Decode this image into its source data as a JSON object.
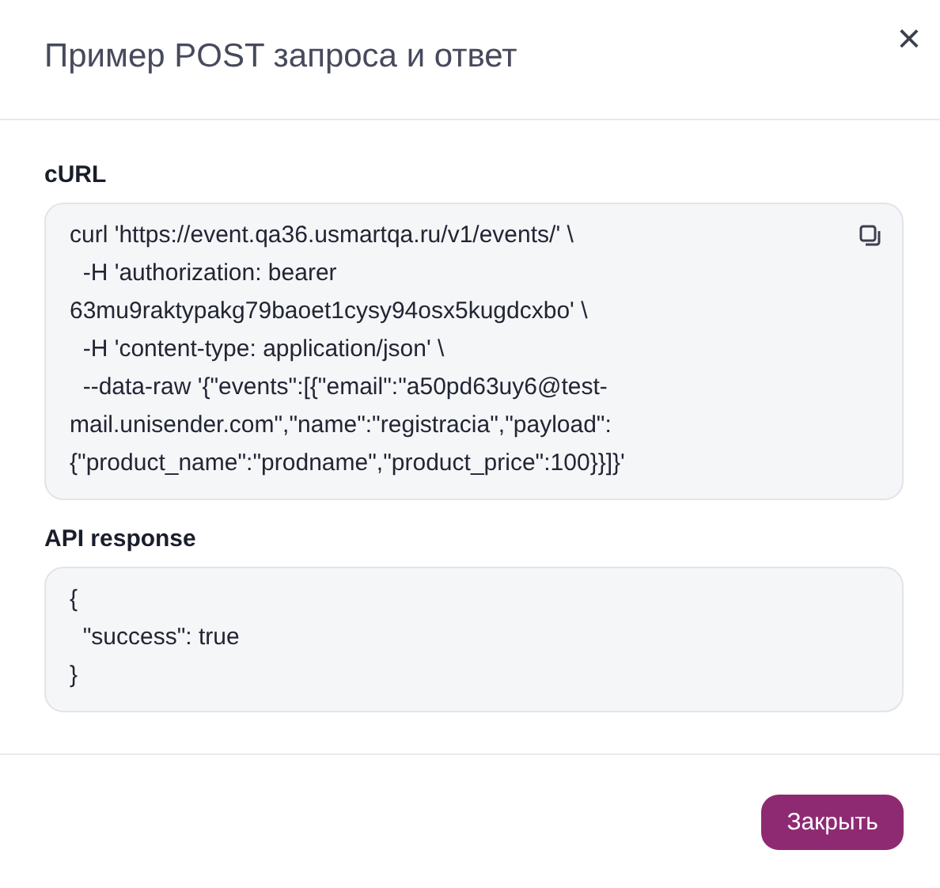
{
  "dialog": {
    "title": "Пример POST запроса и ответ",
    "close": "×"
  },
  "sections": [
    {
      "label": "cURL",
      "copyable": true,
      "lines": [
        "curl 'https://event.qa36.usmartqa.ru/v1/events/' \\",
        "  -H 'authorization: bearer",
        "63mu9raktypakg79baoet1cysy94osx5kugdcxbo' \\",
        "  -H 'content-type: application/json' \\",
        "  --data-raw '{\"events\":[{\"email\":\"a50pd63uy6@test-",
        "mail.unisender.com\",\"name\":\"registracia\",\"payload\":",
        "{\"product_name\":\"prodname\",\"product_price\":100}}]}'"
      ]
    },
    {
      "label": "API response",
      "copyable": false,
      "lines": [
        "{",
        "  \"success\": true",
        "}"
      ]
    }
  ],
  "buttons": [
    "Закрыть"
  ]
}
